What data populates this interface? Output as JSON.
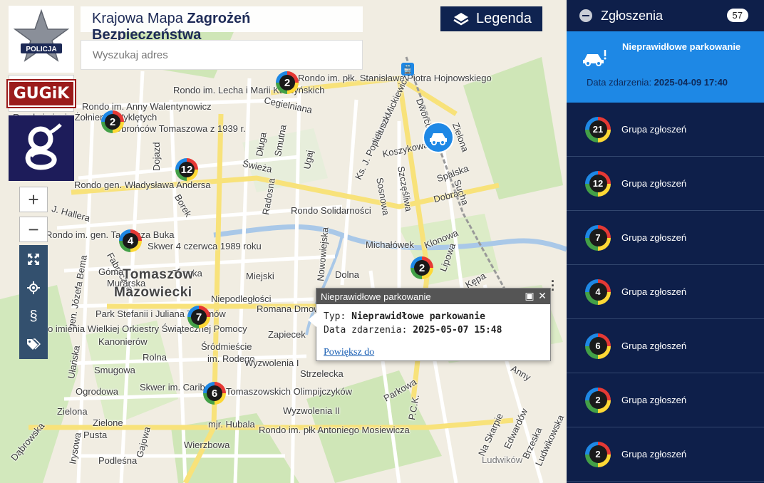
{
  "header": {
    "title_prefix": "Krajowa Mapa ",
    "title_bold": "Zagrożeń Bezpieczeństwa",
    "search_placeholder": "Wyszukaj adres",
    "legend_label": "Legenda"
  },
  "logos": {
    "police_text": "POLICJA",
    "gugik_text": "GUGiK"
  },
  "zoom": {
    "in": "+",
    "out": "−"
  },
  "map": {
    "city_name_1": "Tomaszów",
    "city_name_2": "Mazowiecki",
    "labels": [
      "Rondo im. płk. Stanisława Piotra Hojnowskiego",
      "Rondo im. Lecha i Marii Kaczyńskich",
      "Cegielniana",
      "Rondo im. Anny Walentynowicz",
      "Rondo imienia Żołnierzy Wyklętych",
      "Obrońców Tomaszowa z 1939 r.",
      "Rondo gen. Władysława Andersa",
      "Dojazd",
      "Długa",
      "Smutna",
      "Ugaj",
      "Adama Mickiewicza",
      "Ks. J. Popiełuszki",
      "Koszykowa",
      "Dworcowa",
      "Zielona",
      "Spalska",
      "Sucha",
      "Dobra",
      "Sosnowa",
      "Szczęśliwa",
      "Świeża",
      "Radosna",
      "Borek",
      "J. Hallera",
      "Rondo Solidarności",
      "Rondo im. gen. Tadeusza Buka",
      "Skwer 4 czerwca 1989 roku",
      "Fabryczna",
      "Michałówek",
      "Klonowa",
      "Lipowa",
      "Nowowiejska",
      "Dolna",
      "Miejski",
      "Niepodległości",
      "Romana Dmowskiego",
      "Gómа",
      "Murarska",
      "Tkacka",
      "gen. Józefa Bema",
      "Park Stefanii i Juliana Tuwimów",
      "Rondo imienia Wielkiej Orkiestry Świątecznej Pomocy",
      "Zapiecek",
      "Kanonierów",
      "Śródmieście",
      "im. Rodego",
      "Wyzwolenia I",
      "Rolna",
      "Smugowa",
      "Strzelecka",
      "Skwer im. Cariboni",
      "Tomaszowskich Olimpijczyków",
      "Ogrodowa",
      "Zielona",
      "Zielone",
      "Wyzwolenia II",
      "Parkowa",
      "P.C.K.",
      "Kępa",
      "Anny",
      "Dąbrowska",
      "Irysowa",
      "Pusta",
      "Gajowa",
      "mjr. Hubala",
      "Rondo im. płk Antoniego Mosiewicza",
      "Wierzbowa",
      "Podleśna",
      "Ułańska",
      "Na Skarpie",
      "Edwardów",
      "Brzeska",
      "Ludwików",
      "Ludwikowska"
    ]
  },
  "clusters": [
    {
      "id": "c1",
      "count": "2"
    },
    {
      "id": "c2",
      "count": "2"
    },
    {
      "id": "c3",
      "count": "12"
    },
    {
      "id": "c4",
      "count": "4"
    },
    {
      "id": "c5",
      "count": "2"
    },
    {
      "id": "c6",
      "count": "7"
    },
    {
      "id": "c7",
      "count": "6"
    }
  ],
  "popup": {
    "title": "Nieprawidłowe parkowanie",
    "type_label": "Typ: ",
    "type_value": "Nieprawidłowe parkowanie",
    "date_label": "Data zdarzenia: ",
    "date_value": "2025-05-07 15:48",
    "link": "Powiększ do"
  },
  "panel": {
    "title": "Zgłoszenia",
    "count": "57",
    "active": {
      "title": "Nieprawidłowe parkowanie",
      "date_label": "Data zdarzenia: ",
      "date_value": "2025-04-09 17:40"
    },
    "groups": [
      {
        "count": "21",
        "label": "Grupa zgłoszeń"
      },
      {
        "count": "12",
        "label": "Grupa zgłoszeń"
      },
      {
        "count": "7",
        "label": "Grupa zgłoszeń"
      },
      {
        "count": "4",
        "label": "Grupa zgłoszeń"
      },
      {
        "count": "6",
        "label": "Grupa zgłoszeń"
      },
      {
        "count": "2",
        "label": "Grupa zgłoszeń"
      },
      {
        "count": "2",
        "label": "Grupa zgłoszeń"
      }
    ]
  },
  "colors": {
    "panel_bg": "#0e1f4a",
    "active_bg": "#1e88e5",
    "legend_bg": "#0f2350",
    "tools_bg": "#33506e"
  }
}
